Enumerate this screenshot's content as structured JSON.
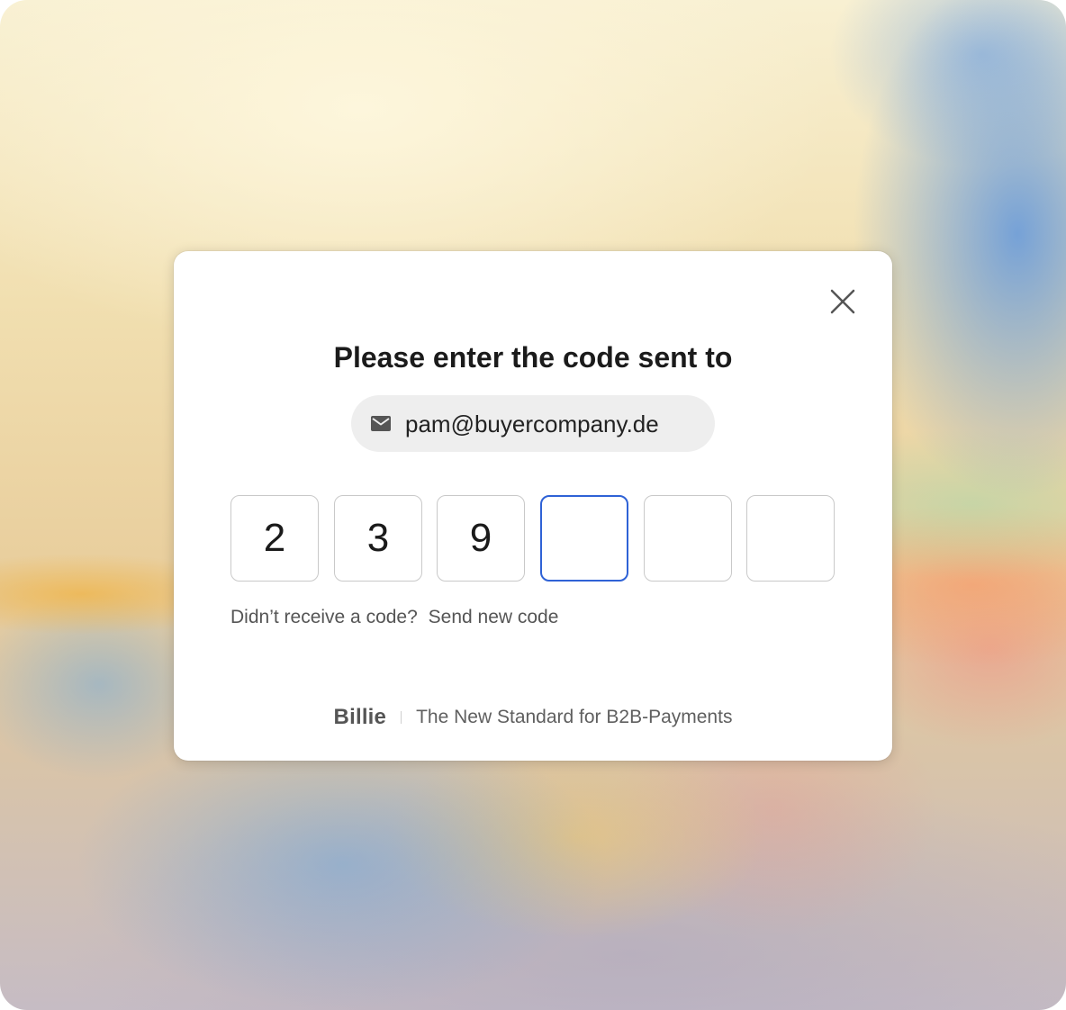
{
  "dialog": {
    "title": "Please enter the code sent to",
    "email": "pam@buyercompany.de",
    "email_icon": "mail-icon",
    "close_icon": "close-icon",
    "code_digits": [
      "2",
      "3",
      "9",
      "",
      "",
      ""
    ],
    "active_index": 3,
    "resend_prompt": "Didn’t receive a code?",
    "resend_link": "Send new code",
    "footer_logo": "Billie",
    "footer_tagline": "The New Standard for B2B-Payments"
  },
  "colors": {
    "active_border": "#2f62d6",
    "box_border": "#c9c9c9",
    "pill_background": "#eeeeee"
  }
}
